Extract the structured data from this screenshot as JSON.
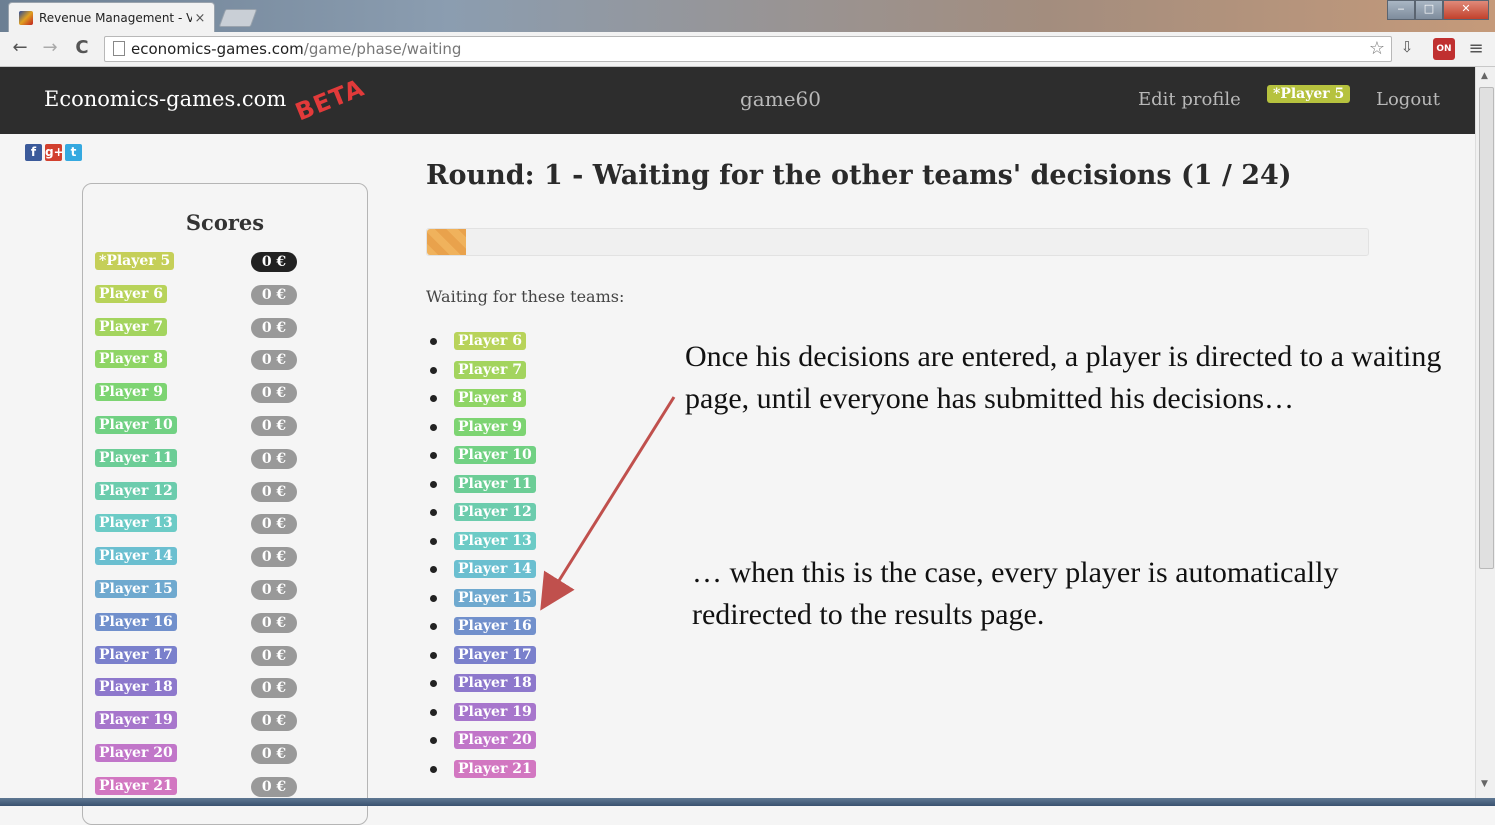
{
  "browser": {
    "tab_title": "Revenue Management - V",
    "tab_close": "×",
    "url_host": "economics-games.com",
    "url_path": "/game/phase/waiting",
    "back_icon": "←",
    "forward_icon": "→",
    "reload_icon": "C",
    "star_icon": "☆",
    "ext_on_label": "ON",
    "menu_icon": "≡",
    "win_min": "‒",
    "win_max": "□",
    "win_close": "✕"
  },
  "site": {
    "brand": "Economics-games.com",
    "beta": "BETA",
    "game_name": "game60",
    "edit_profile": "Edit profile",
    "current_player": "*Player 5",
    "logout": "Logout"
  },
  "social": {
    "facebook": "f",
    "google": "g+",
    "twitter": "t"
  },
  "scores": {
    "title": "Scores",
    "rows": [
      {
        "name": "*Player 5",
        "score": "0 €",
        "color": "#c5cf58",
        "badge": "#222222"
      },
      {
        "name": "Player 6",
        "score": "0 €",
        "color": "#b8d35a",
        "badge": "#999999"
      },
      {
        "name": "Player 7",
        "score": "0 €",
        "color": "#a3d45e",
        "badge": "#999999"
      },
      {
        "name": "Player 8",
        "score": "0 €",
        "color": "#8fd565",
        "badge": "#999999"
      },
      {
        "name": "Player 9",
        "score": "0 €",
        "color": "#7dd472",
        "badge": "#999999"
      },
      {
        "name": "Player 10",
        "score": "0 €",
        "color": "#71d183",
        "badge": "#999999"
      },
      {
        "name": "Player 11",
        "score": "0 €",
        "color": "#6ccd96",
        "badge": "#999999"
      },
      {
        "name": "Player 12",
        "score": "0 €",
        "color": "#6cccad",
        "badge": "#999999"
      },
      {
        "name": "Player 13",
        "score": "0 €",
        "color": "#6ccbc6",
        "badge": "#999999"
      },
      {
        "name": "Player 14",
        "score": "0 €",
        "color": "#6bbfd0",
        "badge": "#999999"
      },
      {
        "name": "Player 15",
        "score": "0 €",
        "color": "#6fa9cf",
        "badge": "#999999"
      },
      {
        "name": "Player 16",
        "score": "0 €",
        "color": "#7190cc",
        "badge": "#999999"
      },
      {
        "name": "Player 17",
        "score": "0 €",
        "color": "#7a80cc",
        "badge": "#999999"
      },
      {
        "name": "Player 18",
        "score": "0 €",
        "color": "#8d78cc",
        "badge": "#999999"
      },
      {
        "name": "Player 19",
        "score": "0 €",
        "color": "#a776cc",
        "badge": "#999999"
      },
      {
        "name": "Player 20",
        "score": "0 €",
        "color": "#c176c9",
        "badge": "#999999"
      },
      {
        "name": "Player 21",
        "score": "0 €",
        "color": "#d277c1",
        "badge": "#999999"
      }
    ]
  },
  "main": {
    "round_title": "Round: 1 - Waiting for the other teams' decisions (1 / 24)",
    "progress_fraction": 0.0417,
    "waiting_label": "Waiting for these teams:",
    "waiting_teams": [
      {
        "name": "Player 6",
        "color": "#b8d35a"
      },
      {
        "name": "Player 7",
        "color": "#a3d45e"
      },
      {
        "name": "Player 8",
        "color": "#8fd565"
      },
      {
        "name": "Player 9",
        "color": "#7dd472"
      },
      {
        "name": "Player 10",
        "color": "#71d183"
      },
      {
        "name": "Player 11",
        "color": "#6ccd96"
      },
      {
        "name": "Player 12",
        "color": "#6cccad"
      },
      {
        "name": "Player 13",
        "color": "#6ccbc6"
      },
      {
        "name": "Player 14",
        "color": "#6bbfd0"
      },
      {
        "name": "Player 15",
        "color": "#6fa9cf"
      },
      {
        "name": "Player 16",
        "color": "#7190cc"
      },
      {
        "name": "Player 17",
        "color": "#7a80cc"
      },
      {
        "name": "Player 18",
        "color": "#8d78cc"
      },
      {
        "name": "Player 19",
        "color": "#a776cc"
      },
      {
        "name": "Player 20",
        "color": "#c176c9"
      },
      {
        "name": "Player 21",
        "color": "#d277c1"
      }
    ]
  },
  "annotations": {
    "text1": "Once his decisions are entered, a player is directed to a waiting page, until everyone has submitted his decisions…",
    "text2": "… when this is the case, every player is automatically redirected to the results page."
  }
}
